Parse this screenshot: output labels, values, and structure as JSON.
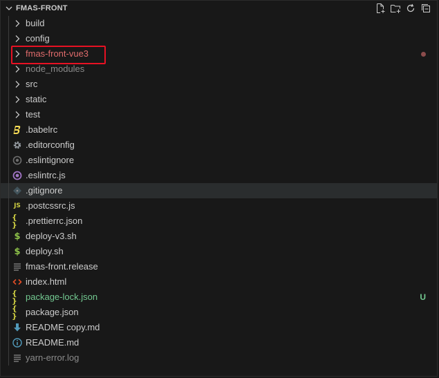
{
  "explorer": {
    "title": "FMAS-FRONT",
    "actions": [
      {
        "name": "new-file-icon"
      },
      {
        "name": "new-folder-icon"
      },
      {
        "name": "refresh-icon"
      },
      {
        "name": "collapse-all-icon"
      }
    ]
  },
  "tree": {
    "items": [
      {
        "label": "build",
        "kind": "folder"
      },
      {
        "label": "config",
        "kind": "folder"
      },
      {
        "label": "fmas-front-vue3",
        "kind": "folder",
        "git": "modified",
        "highlighted": true
      },
      {
        "label": "node_modules",
        "kind": "folder",
        "dim": true
      },
      {
        "label": "src",
        "kind": "folder"
      },
      {
        "label": "static",
        "kind": "folder"
      },
      {
        "label": "test",
        "kind": "folder"
      },
      {
        "label": ".babelrc",
        "kind": "file",
        "icon": "babel-icon"
      },
      {
        "label": ".editorconfig",
        "kind": "file",
        "icon": "gear-icon"
      },
      {
        "label": ".eslintignore",
        "kind": "file",
        "icon": "eslint-ignore-icon"
      },
      {
        "label": ".eslintrc.js",
        "kind": "file",
        "icon": "eslint-icon"
      },
      {
        "label": ".gitignore",
        "kind": "file",
        "icon": "git-icon",
        "hover": true
      },
      {
        "label": ".postcssrc.js",
        "kind": "file",
        "icon": "js-icon",
        "icon_text": "JS"
      },
      {
        "label": ".prettierrc.json",
        "kind": "file",
        "icon": "json-icon",
        "icon_text": "{}"
      },
      {
        "label": "deploy-v3.sh",
        "kind": "file",
        "icon": "shell-icon",
        "icon_text": "$"
      },
      {
        "label": "deploy.sh",
        "kind": "file",
        "icon": "shell-icon",
        "icon_text": "$"
      },
      {
        "label": "fmas-front.release",
        "kind": "file",
        "icon": "text-lines-icon"
      },
      {
        "label": "index.html",
        "kind": "file",
        "icon": "html-icon",
        "icon_text": "<>"
      },
      {
        "label": "package-lock.json",
        "kind": "file",
        "icon": "json-icon",
        "icon_text": "{}",
        "git": "untracked",
        "badge": "U"
      },
      {
        "label": "package.json",
        "kind": "file",
        "icon": "json-icon",
        "icon_text": "{}"
      },
      {
        "label": "README copy.md",
        "kind": "file",
        "icon": "markdown-download-icon"
      },
      {
        "label": "README.md",
        "kind": "file",
        "icon": "info-icon"
      },
      {
        "label": "yarn-error.log",
        "kind": "file",
        "icon": "text-lines-icon",
        "faded": true
      }
    ]
  },
  "colors": {
    "background": "#181818",
    "text": "#cccccc",
    "modified": "#e06c6c",
    "untracked": "#73c991",
    "highlight_box": "#e81123"
  }
}
